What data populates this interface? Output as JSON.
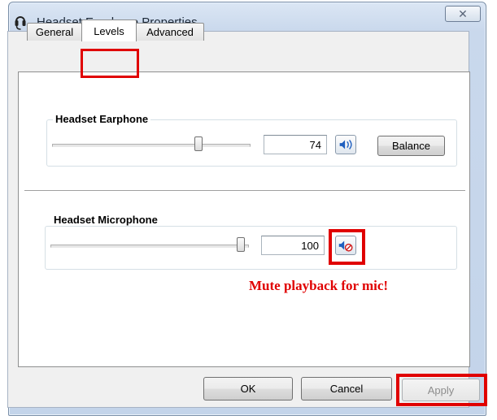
{
  "window": {
    "title": "Headset Earphone Properties",
    "icon": "headset-icon",
    "close_glyph": "✕"
  },
  "tabs": [
    {
      "label": "General",
      "active": false
    },
    {
      "label": "Levels",
      "active": true
    },
    {
      "label": "Advanced",
      "active": false
    }
  ],
  "earphone": {
    "label": "Headset Earphone",
    "level": "74",
    "level_fraction": 0.74,
    "speaker_icon": "speaker-icon",
    "balance_label": "Balance"
  },
  "microphone": {
    "label": "Headset Microphone",
    "level": "100",
    "level_fraction": 1.0,
    "speaker_icon": "speaker-muted-icon"
  },
  "annotation": "Mute playback for mic!",
  "buttons": {
    "ok": "OK",
    "cancel": "Cancel",
    "apply": "Apply"
  },
  "colors": {
    "highlight": "#e00000"
  }
}
